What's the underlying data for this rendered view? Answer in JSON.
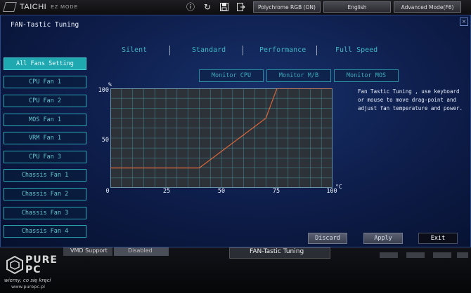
{
  "topbar": {
    "brand": "TAICHI",
    "mode": "EZ MODE",
    "polychrome_button": "Polychrome RGB (ON)",
    "language_button": "English",
    "advanced_button": "Advanced Mode(F6)"
  },
  "panel": {
    "title": "FAN-Tastic Tuning",
    "close": "×"
  },
  "sidebar": {
    "items": [
      {
        "label": "All Fans Setting",
        "active": true
      },
      {
        "label": "CPU Fan 1",
        "active": false
      },
      {
        "label": "CPU Fan 2",
        "active": false
      },
      {
        "label": "MOS Fan 1",
        "active": false
      },
      {
        "label": "VRM Fan 1",
        "active": false
      },
      {
        "label": "CPU Fan 3",
        "active": false
      },
      {
        "label": "Chassis Fan 1",
        "active": false
      },
      {
        "label": "Chassis Fan 2",
        "active": false
      },
      {
        "label": "Chassis Fan 3",
        "active": false
      },
      {
        "label": "Chassis Fan 4",
        "active": false
      }
    ]
  },
  "presets": [
    "Silent",
    "Standard",
    "Performance",
    "Full Speed"
  ],
  "monitors": [
    "Monitor CPU",
    "Monitor M/B",
    "Monitor MOS"
  ],
  "chart_data": {
    "type": "line",
    "ylabel": "%",
    "xlabel": "°C",
    "xlim": [
      0,
      100
    ],
    "ylim": [
      0,
      100
    ],
    "x_ticks": [
      0,
      25,
      50,
      75,
      100
    ],
    "y_ticks": [
      50,
      100
    ],
    "grid": true,
    "colors": {
      "line": "#d9673a",
      "grid": "#4aa0a8",
      "background": "#2d3138"
    },
    "series": [
      {
        "x": [
          0,
          40,
          70,
          75,
          100
        ],
        "y": [
          20,
          20,
          70,
          100,
          100
        ]
      }
    ]
  },
  "help_text": "Fan Tastic Tuning , use keyboard or mouse to move drag-point and adjust fan temperature and power.",
  "actions": {
    "discard": "Discard",
    "apply": "Apply",
    "exit": "Exit"
  },
  "bottom": {
    "vmd_label": "VMD Support",
    "vmd_value": "Disabled",
    "tab_label": "FAN-Tastic Tuning"
  },
  "watermark": {
    "brand_line1": "PURE",
    "brand_line2": "PC",
    "tagline": "wiemy, co się kręci",
    "url": "www.purepc.pl"
  }
}
